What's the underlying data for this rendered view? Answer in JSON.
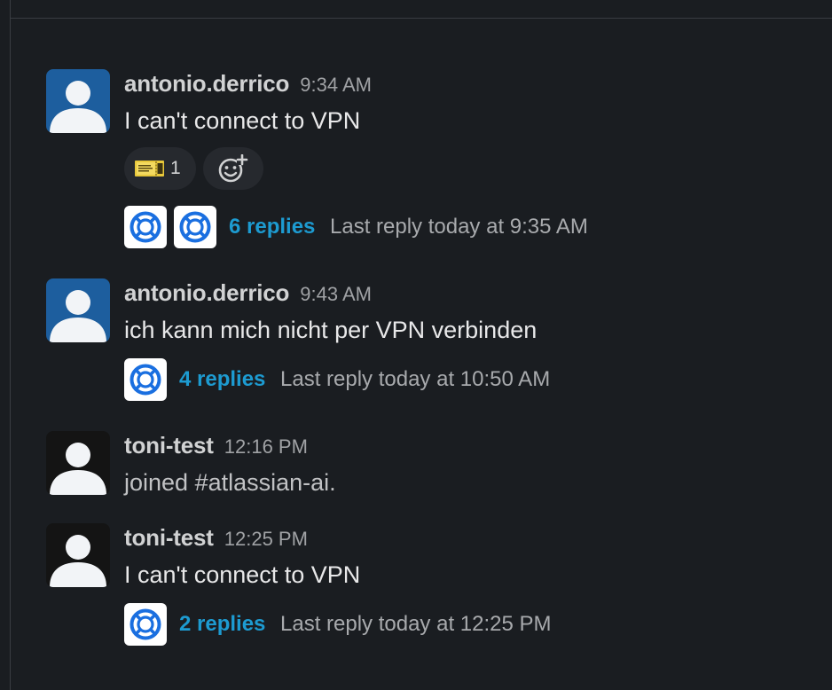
{
  "messages": [
    {
      "author": "antonio.derrico",
      "time": "9:34 AM",
      "text": "I can't connect to VPN",
      "avatar_color": "#1d5e9e",
      "reactions": [
        {
          "icon": "ticket-emoji-icon",
          "count": "1"
        }
      ],
      "add_reaction_icon": "add-reaction-icon",
      "thread": {
        "replies": "6 replies",
        "last_reply": "Last reply today at 9:35 AM"
      }
    },
    {
      "author": "antonio.derrico",
      "time": "9:43 AM",
      "text": "ich kann mich nicht per VPN verbinden",
      "avatar_color": "#1d5e9e",
      "thread": {
        "replies": "4 replies",
        "last_reply": "Last reply today at 10:50 AM"
      }
    },
    {
      "author": "toni-test",
      "time": "12:16 PM",
      "text": "joined #atlassian-ai.",
      "avatar_color": "#141414"
    },
    {
      "author": "toni-test",
      "time": "12:25 PM",
      "text": "I can't connect to VPN",
      "avatar_color": "#141414",
      "thread": {
        "replies": "2 replies",
        "last_reply": "Last reply today at 12:25 PM"
      }
    }
  ],
  "colors": {
    "background": "#1a1d21",
    "link": "#1d9bd1",
    "app_icon_blue": "#1a6fe0"
  }
}
